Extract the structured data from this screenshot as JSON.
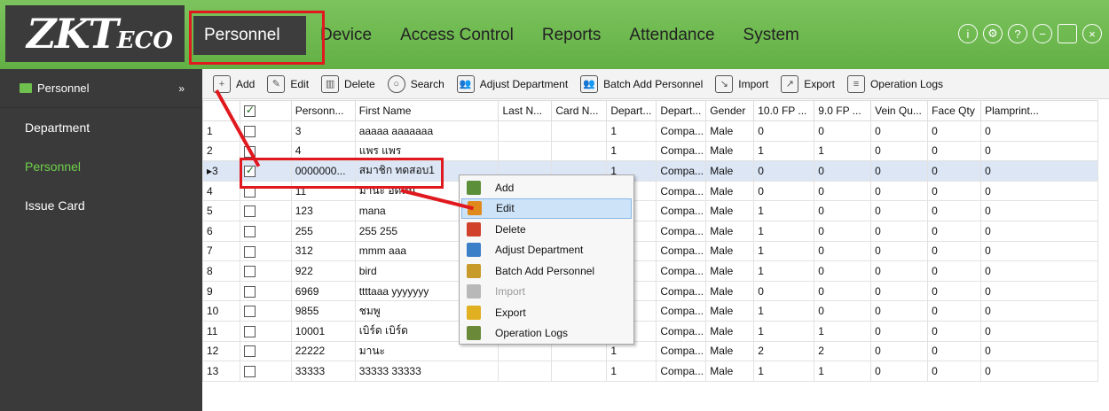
{
  "logo": {
    "main": "ZKT",
    "sub": "ECO"
  },
  "nav": {
    "tabs": [
      "Personnel",
      "Device",
      "Access Control",
      "Reports",
      "Attendance",
      "System"
    ],
    "active": "Personnel"
  },
  "window_controls": [
    "info-icon",
    "gear-icon",
    "help-icon",
    "minimize-icon",
    "maximize-icon",
    "close-icon"
  ],
  "sidebar": {
    "header": "Personnel",
    "items": [
      "Department",
      "Personnel",
      "Issue Card"
    ],
    "active": "Personnel"
  },
  "toolbar": {
    "buttons": [
      "Add",
      "Edit",
      "Delete",
      "Search",
      "Adjust Department",
      "Batch Add Personnel",
      "Import",
      "Export",
      "Operation Logs"
    ]
  },
  "table": {
    "columns": [
      "",
      "",
      "Personn...",
      "First Name",
      "Last N...",
      "Card N...",
      "Depart...",
      "Depart...",
      "Gender",
      "10.0 FP ...",
      "9.0 FP ...",
      "Vein Qu...",
      "Face Qty",
      "Plamprint..."
    ],
    "rows": [
      {
        "n": "1",
        "checked": false,
        "id": "3",
        "first": "aaaaa aaaaaaa",
        "last": "",
        "card": "",
        "dept": "1",
        "dname": "Compa...",
        "gender": "Male",
        "fp10": "0",
        "fp9": "0",
        "vein": "0",
        "face": "0",
        "palm": "0"
      },
      {
        "n": "2",
        "checked": false,
        "id": "4",
        "first": "แพร แพร",
        "last": "",
        "card": "",
        "dept": "1",
        "dname": "Compa...",
        "gender": "Male",
        "fp10": "1",
        "fp9": "1",
        "vein": "0",
        "face": "0",
        "palm": "0"
      },
      {
        "n": "▸3",
        "checked": true,
        "id": "0000000...",
        "first": "สมาชิก ทดสอบ1",
        "last": "",
        "card": "",
        "dept": "1",
        "dname": "Compa...",
        "gender": "Male",
        "fp10": "0",
        "fp9": "0",
        "vein": "0",
        "face": "0",
        "palm": "0"
      },
      {
        "n": "4",
        "checked": false,
        "id": "11",
        "first": "มานะ อดทน",
        "last": "",
        "card": "",
        "dept": "",
        "dname": "Compa...",
        "gender": "Male",
        "fp10": "0",
        "fp9": "0",
        "vein": "0",
        "face": "0",
        "palm": "0"
      },
      {
        "n": "5",
        "checked": false,
        "id": "123",
        "first": "mana",
        "last": "",
        "card": "",
        "dept": "",
        "dname": "Compa...",
        "gender": "Male",
        "fp10": "1",
        "fp9": "0",
        "vein": "0",
        "face": "0",
        "palm": "0"
      },
      {
        "n": "6",
        "checked": false,
        "id": "255",
        "first": "255 255",
        "last": "",
        "card": "",
        "dept": "",
        "dname": "Compa...",
        "gender": "Male",
        "fp10": "1",
        "fp9": "0",
        "vein": "0",
        "face": "0",
        "palm": "0"
      },
      {
        "n": "7",
        "checked": false,
        "id": "312",
        "first": "mmm aaa",
        "last": "",
        "card": "",
        "dept": "",
        "dname": "Compa...",
        "gender": "Male",
        "fp10": "1",
        "fp9": "0",
        "vein": "0",
        "face": "0",
        "palm": "0"
      },
      {
        "n": "8",
        "checked": false,
        "id": "922",
        "first": "bird",
        "last": "",
        "card": "",
        "dept": "",
        "dname": "Compa...",
        "gender": "Male",
        "fp10": "1",
        "fp9": "0",
        "vein": "0",
        "face": "0",
        "palm": "0"
      },
      {
        "n": "9",
        "checked": false,
        "id": "6969",
        "first": "ttttaaa yyyyyyy",
        "last": "",
        "card": "",
        "dept": "",
        "dname": "Compa...",
        "gender": "Male",
        "fp10": "0",
        "fp9": "0",
        "vein": "0",
        "face": "0",
        "palm": "0"
      },
      {
        "n": "10",
        "checked": false,
        "id": "9855",
        "first": "ชมพู",
        "last": "",
        "card": "",
        "dept": "",
        "dname": "Compa...",
        "gender": "Male",
        "fp10": "1",
        "fp9": "0",
        "vein": "0",
        "face": "0",
        "palm": "0"
      },
      {
        "n": "11",
        "checked": false,
        "id": "10001",
        "first": "เบิร์ด เบิร์ด",
        "last": "",
        "card": "",
        "dept": "",
        "dname": "Compa...",
        "gender": "Male",
        "fp10": "1",
        "fp9": "1",
        "vein": "0",
        "face": "0",
        "palm": "0"
      },
      {
        "n": "12",
        "checked": false,
        "id": "22222",
        "first": "มานะ",
        "last": "",
        "card": "",
        "dept": "1",
        "dname": "Compa...",
        "gender": "Male",
        "fp10": "2",
        "fp9": "2",
        "vein": "0",
        "face": "0",
        "palm": "0"
      },
      {
        "n": "13",
        "checked": false,
        "id": "33333",
        "first": "33333 33333",
        "last": "",
        "card": "",
        "dept": "1",
        "dname": "Compa...",
        "gender": "Male",
        "fp10": "1",
        "fp9": "1",
        "vein": "0",
        "face": "0",
        "palm": "0"
      }
    ]
  },
  "context_menu": {
    "items": [
      {
        "label": "Add",
        "icon": "add-icon",
        "color": "#5c8f3a",
        "state": "normal"
      },
      {
        "label": "Edit",
        "icon": "edit-icon",
        "color": "#e08a1e",
        "state": "highlighted"
      },
      {
        "label": "Delete",
        "icon": "delete-icon",
        "color": "#d0402a",
        "state": "normal"
      },
      {
        "label": "Adjust Department",
        "icon": "adjust-department-icon",
        "color": "#3a7fc8",
        "state": "normal"
      },
      {
        "label": "Batch Add Personnel",
        "icon": "batch-add-icon",
        "color": "#c89a2a",
        "state": "normal"
      },
      {
        "label": "Import",
        "icon": "import-icon",
        "color": "#b8b8b8",
        "state": "disabled"
      },
      {
        "label": "Export",
        "icon": "export-icon",
        "color": "#e0b020",
        "state": "normal"
      },
      {
        "label": "Operation Logs",
        "icon": "operation-logs-icon",
        "color": "#6a8a3a",
        "state": "normal"
      }
    ]
  },
  "colors": {
    "brand_green": "#62b045",
    "sidebar_bg": "#3a3a3a",
    "active_green": "#6fd04a",
    "annotation_red": "#e0191f",
    "selected_row": "#dce6f5"
  }
}
